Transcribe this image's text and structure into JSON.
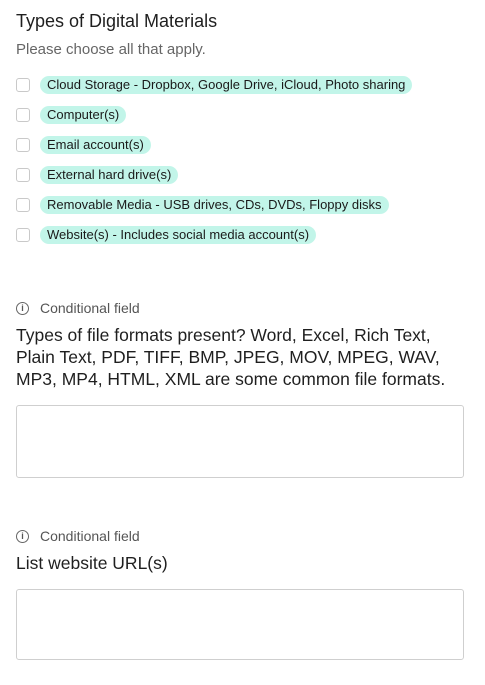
{
  "digital_materials": {
    "title": "Types of Digital Materials",
    "helper": "Please choose all that apply.",
    "options": [
      "Cloud Storage - Dropbox, Google Drive, iCloud, Photo sharing",
      "Computer(s)",
      "Email account(s)",
      "External hard drive(s)",
      "Removable Media - USB drives, CDs, DVDs, Floppy disks",
      "Website(s) - Includes social media account(s)"
    ]
  },
  "file_formats": {
    "conditional_label": "Conditional field",
    "question": "Types of file formats present? Word, Excel, Rich Text, Plain Text, PDF, TIFF, BMP, JPEG, MOV, MPEG, WAV, MP3, MP4, HTML, XML are some common file formats.",
    "value": ""
  },
  "website_urls": {
    "conditional_label": "Conditional field",
    "question": "List website URL(s)",
    "value": ""
  },
  "icons": {
    "info": "info-icon"
  },
  "colors": {
    "chip_bg": "#c2f5e9"
  }
}
